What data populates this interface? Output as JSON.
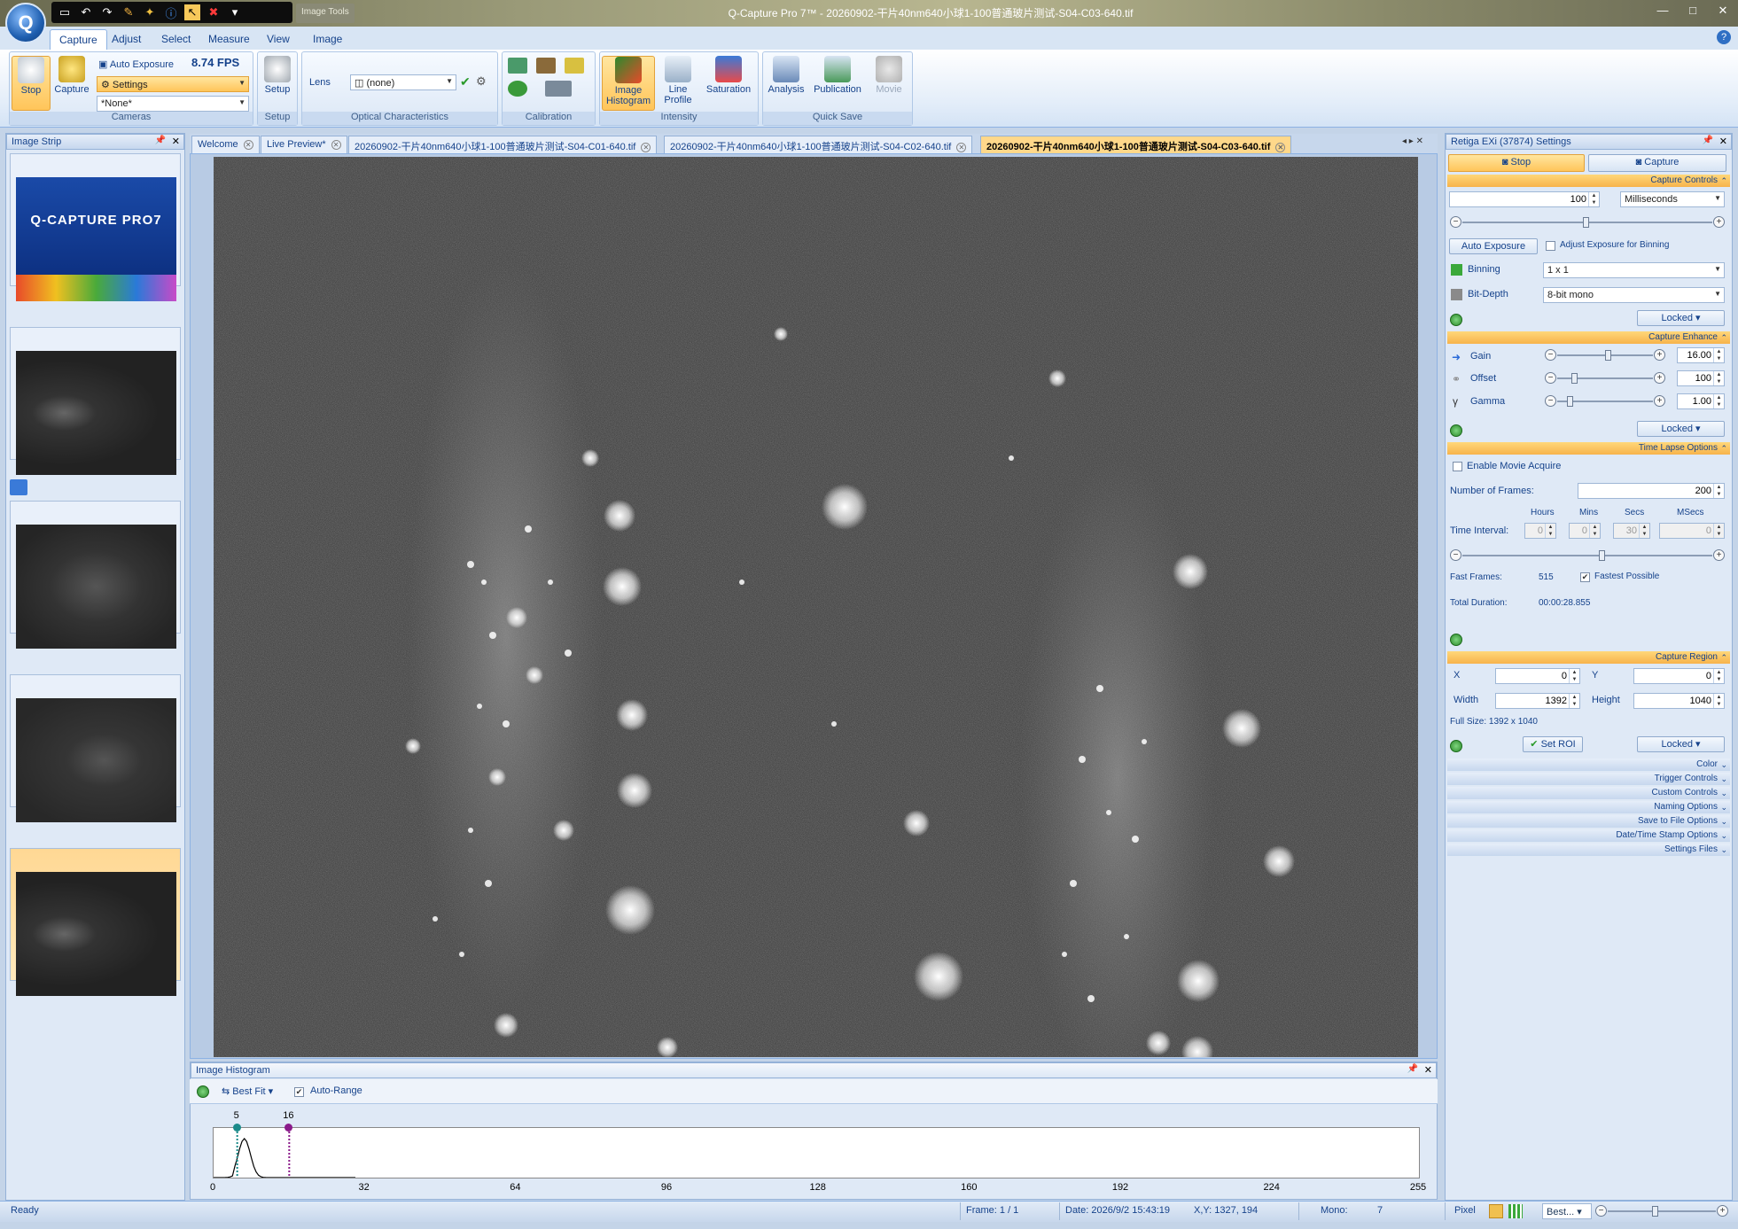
{
  "window": {
    "title": "Q-Capture Pro 7™ - 20260902-干片40nm640小球1-100普通玻片测试-S04-C03-640.tif",
    "image_tools": "Image Tools"
  },
  "ribbon_tabs": [
    "Capture",
    "Adjust",
    "Select",
    "Measure",
    "View",
    "Image"
  ],
  "ribbon": {
    "cameras": {
      "stop": "Stop",
      "capture": "Capture",
      "auto_exposure": "Auto Exposure",
      "fps": "8.74 FPS",
      "settings": "Settings",
      "preset": "*None*",
      "label": "Cameras"
    },
    "setup": {
      "button": "Setup",
      "label": "Setup"
    },
    "optical": {
      "lens_label": "Lens",
      "lens_value": "(none)",
      "label": "Optical Characteristics"
    },
    "calibration": {
      "label": "Calibration"
    },
    "intensity": {
      "image_histogram": "Image Histogram",
      "line_profile": "Line Profile",
      "saturation": "Saturation",
      "label": "Intensity"
    },
    "quick_save": {
      "analysis": "Analysis",
      "publication": "Publication",
      "movie": "Movie",
      "label": "Quick Save"
    }
  },
  "image_strip": {
    "title": "Image Strip",
    "logo_text": "Q-CAPTURE PRO7"
  },
  "doc_tabs": [
    "Welcome",
    "Live Preview*",
    "20260902-干片40nm640小球1-100普通玻片测试-S04-C01-640.tif",
    "20260902-干片40nm640小球1-100普通玻片测试-S04-C02-640.tif",
    "20260902-干片40nm640小球1-100普通玻片测试-S04-C03-640.tif"
  ],
  "histogram": {
    "title": "Image Histogram",
    "fit": "Best Fit",
    "auto_range": "Auto-Range",
    "low_marker": "5",
    "high_marker": "16",
    "ticks": [
      "0",
      "32",
      "64",
      "96",
      "128",
      "160",
      "192",
      "224",
      "255"
    ],
    "low_value": 5,
    "high_value": 16,
    "colors": {
      "low": "#1a8a8a",
      "high": "#8a1a8a"
    }
  },
  "settings": {
    "title": "Retiga EXi (37874) Settings",
    "stop": "Stop",
    "capture": "Capture",
    "capture_controls": "Capture Controls",
    "exposure_value": "100",
    "exposure_unit": "Milliseconds",
    "auto_exposure": "Auto Exposure",
    "adjust_binning": "Adjust Exposure for Binning",
    "binning_label": "Binning",
    "binning_value": "1 x 1",
    "bitdepth_label": "Bit-Depth",
    "bitdepth_value": "8-bit mono",
    "locked": "Locked",
    "capture_enhance": "Capture Enhance",
    "gain_label": "Gain",
    "gain_value": "16.00",
    "offset_label": "Offset",
    "offset_value": "100",
    "gamma_label": "Gamma",
    "gamma_value": "1.00",
    "time_lapse": "Time Lapse Options",
    "enable_movie": "Enable Movie Acquire",
    "num_frames_label": "Number of  Frames:",
    "num_frames": "200",
    "hours": "Hours",
    "mins": "Mins",
    "secs": "Secs",
    "msecs": "MSecs",
    "time_interval": "Time Interval:",
    "ti_hours": "0",
    "ti_mins": "0",
    "ti_secs": "30",
    "ti_msecs": "0",
    "fast_frames_label": "Fast Frames:",
    "fast_frames": "515",
    "fastest_possible": "Fastest Possible",
    "total_duration_label": "Total Duration:",
    "total_duration": "00:00:28.855",
    "capture_region": "Capture Region",
    "x_label": "X",
    "x_value": "0",
    "y_label": "Y",
    "y_value": "0",
    "width_label": "Width",
    "width_value": "1392",
    "height_label": "Height",
    "height_value": "1040",
    "full_size": "Full Size: 1392 x 1040",
    "set_roi": "Set ROI",
    "collapsed_sections": [
      "Color",
      "Trigger Controls",
      "Custom Controls",
      "Naming Options",
      "Save to File Options",
      "Date/Time Stamp Options",
      "Settings Files"
    ]
  },
  "status": {
    "ready": "Ready",
    "frame": "Frame: 1 / 1",
    "date": "Date: 2026/9/2 15:43:19",
    "xy": "X,Y: 1327,  194",
    "mono_label": "Mono:",
    "mono_value": "7",
    "pixel": "Pixel",
    "zoom": "Best..."
  }
}
